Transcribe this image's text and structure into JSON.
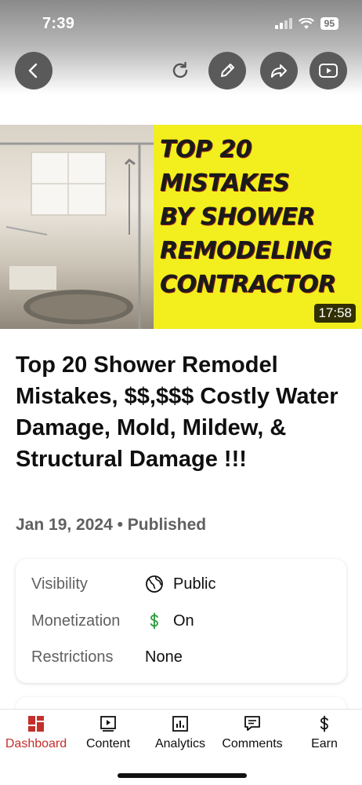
{
  "status_bar": {
    "time": "7:39",
    "battery": "95"
  },
  "top_bar": {
    "icons": [
      "back-icon",
      "refresh-icon",
      "edit-icon",
      "share-icon",
      "youtube-icon"
    ]
  },
  "video": {
    "thumbnail_lines": [
      "TOP 20",
      "MISTAKES",
      "BY SHOWER",
      "REMODELING",
      "CONTRACTOR"
    ],
    "duration": "17:58",
    "title": "Top 20 Shower Remodel Mistakes, $$,$$$ Costly Water Damage, Mold, Mildew, & Structural Damage !!!",
    "meta": "Jan 19, 2024 • Published"
  },
  "details": {
    "visibility_label": "Visibility",
    "visibility_value": "Public",
    "monetization_label": "Monetization",
    "monetization_value": "On",
    "restrictions_label": "Restrictions",
    "restrictions_value": "None"
  },
  "bottom_nav": {
    "items": [
      {
        "label": "Dashboard",
        "icon": "dashboard-icon",
        "active": true
      },
      {
        "label": "Content",
        "icon": "content-icon",
        "active": false
      },
      {
        "label": "Analytics",
        "icon": "analytics-icon",
        "active": false
      },
      {
        "label": "Comments",
        "icon": "comments-icon",
        "active": false
      },
      {
        "label": "Earn",
        "icon": "dollar-icon",
        "active": false
      }
    ]
  },
  "colors": {
    "accent": "#c4302b",
    "monetization_green": "#2f9e44",
    "thumbnail_yellow": "#f3ee1d"
  }
}
